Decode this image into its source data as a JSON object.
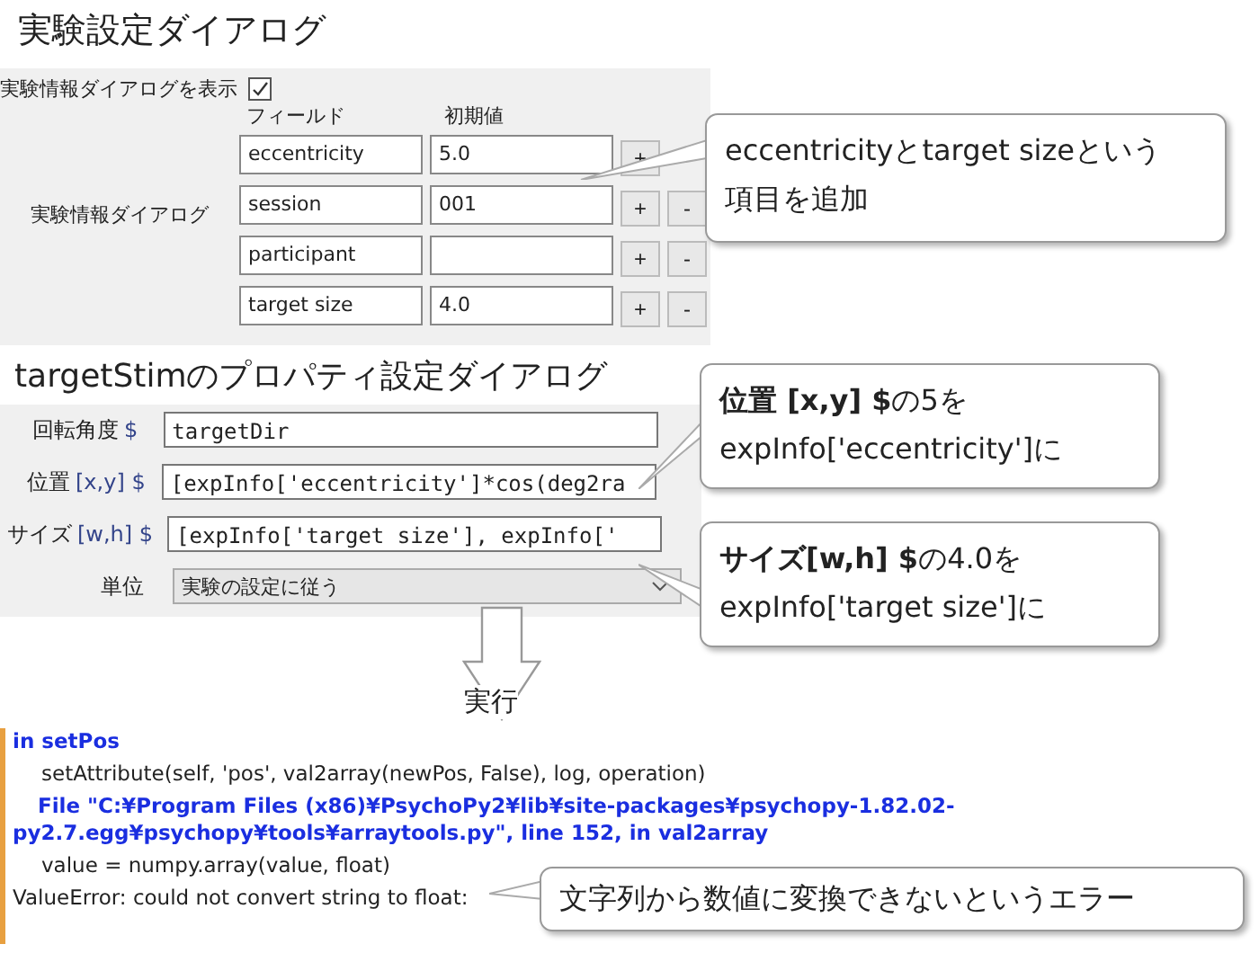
{
  "experiment_dialog": {
    "title": "実験設定ダイアログ",
    "show_info_label": "実験情報ダイアログを表示",
    "show_info_checked": true,
    "info_label": "実験情報ダイアログ",
    "columns": [
      "フィールド",
      "初期値"
    ],
    "fields": [
      {
        "name": "eccentricity",
        "value": "5.0",
        "add": "+"
      },
      {
        "name": "session",
        "value": "001",
        "add": "+",
        "remove": "-"
      },
      {
        "name": "participant",
        "add": "+",
        "remove": "-"
      },
      {
        "name": "target size",
        "value": "4.0",
        "add": "+",
        "remove": "-"
      }
    ]
  },
  "property_dialog": {
    "title": "targetStimのプロパティ設定ダイアログ",
    "rows": [
      {
        "kind": "text",
        "label": "回転角度",
        "params": "$",
        "value": "targetDir"
      },
      {
        "kind": "text",
        "label": "位置",
        "params": "[x,y] $",
        "value": "[expInfo['eccentricity']*cos(deg2ra"
      },
      {
        "kind": "text",
        "label": "サイズ",
        "params": "[w,h] $",
        "value": "[expInfo['target size'], expInfo['"
      },
      {
        "kind": "select",
        "label": "単位",
        "value": "実験の設定に従う"
      }
    ]
  },
  "run_arrow": {
    "label": "実行"
  },
  "error_output": {
    "lines": [
      {
        "kind": "location",
        "text": "in setPos"
      },
      {
        "kind": "code",
        "text": "setAttribute(self, 'pos', val2array(newPos, False), log, operation)"
      },
      {
        "kind": "location",
        "text": "File \"C:¥Program Files (x86)¥PsychoPy2¥lib¥site-packages¥psychopy-1.82.02-py2.7.egg¥psychopy¥tools¥arraytools.py\", line 152, in val2array"
      },
      {
        "kind": "code",
        "text": "value = numpy.array(value, float)"
      },
      {
        "kind": "error",
        "text": "ValueError: could not convert string to float:"
      }
    ]
  },
  "callouts": [
    {
      "text": "eccentricityとtarget sizeという項目を追加"
    },
    {
      "text": "**位置 [x,y] $**の5を\nexpInfo['eccentricity']に"
    },
    {
      "text": "**サイズ[w,h] $**の4.0を\nexpInfo['target size']に"
    },
    {
      "text": "文字列から数値に変換できないというエラー"
    }
  ]
}
